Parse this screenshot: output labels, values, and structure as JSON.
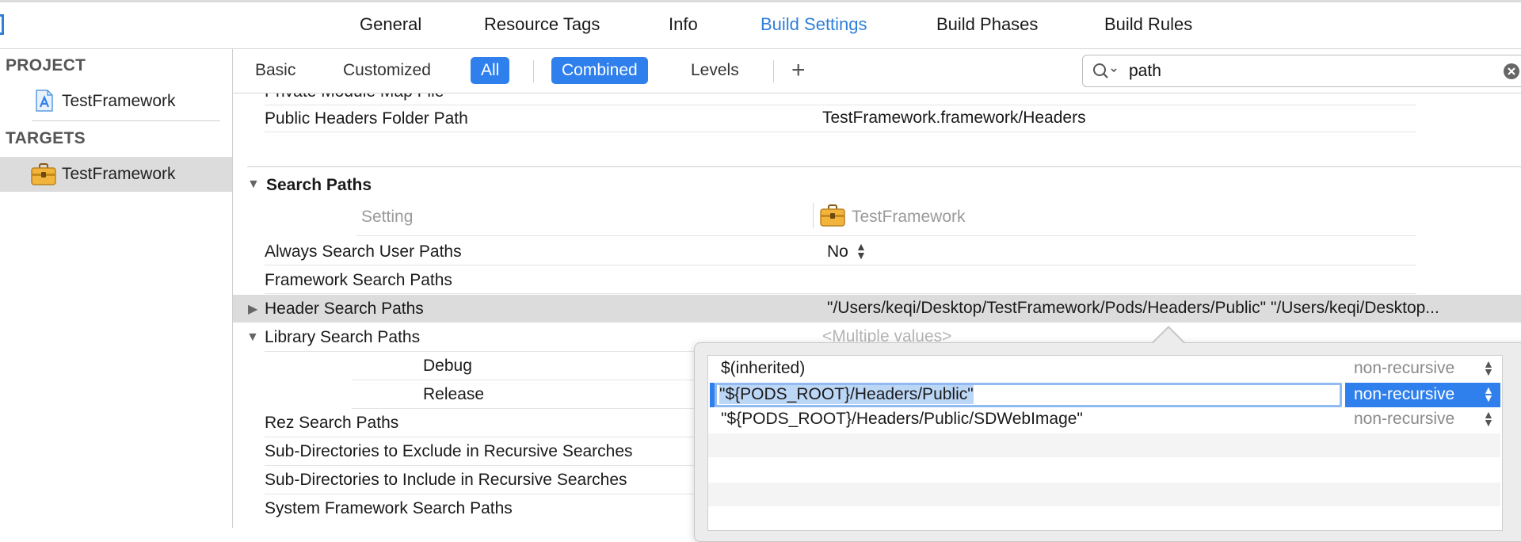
{
  "tabs": [
    "General",
    "Resource Tags",
    "Info",
    "Build Settings",
    "Build Phases",
    "Build Rules"
  ],
  "active_tab": "Build Settings",
  "sidebar": {
    "project_header": "PROJECT",
    "project_item": "TestFramework",
    "targets_header": "TARGETS",
    "target_item": "TestFramework"
  },
  "filter": {
    "basic": "Basic",
    "customized": "Customized",
    "all": "All",
    "combined": "Combined",
    "levels": "Levels",
    "add": "+"
  },
  "search": {
    "value": "path"
  },
  "settings": {
    "cut_row_label": "Private Module Map File",
    "public_headers_label": "Public Headers Folder Path",
    "public_headers_value": "TestFramework.framework/Headers",
    "section_title": "Search Paths",
    "col_setting": "Setting",
    "col_target": "TestFramework",
    "always_search_label": "Always Search User Paths",
    "always_search_value": "No",
    "framework_search_label": "Framework Search Paths",
    "header_search_label": "Header Search Paths",
    "header_search_value": "\"/Users/keqi/Desktop/TestFramework/Pods/Headers/Public\" \"/Users/keqi/Desktop...",
    "library_search_label": "Library Search Paths",
    "library_search_value": "<Multiple values>",
    "debug_label": "Debug",
    "release_label": "Release",
    "rez_label": "Rez Search Paths",
    "subdir_exclude_label": "Sub-Directories to Exclude in Recursive Searches",
    "subdir_include_label": "Sub-Directories to Include in Recursive Searches",
    "system_framework_label": "System Framework Search Paths"
  },
  "popover": {
    "rows": [
      {
        "path": "$(inherited)",
        "mode": "non-recursive"
      },
      {
        "path": "\"${PODS_ROOT}/Headers/Public\"",
        "mode": "non-recursive"
      },
      {
        "path": "\"${PODS_ROOT}/Headers/Public/SDWebImage\"",
        "mode": "non-recursive"
      }
    ]
  },
  "colors": {
    "accent": "#2f80ed",
    "active_tab": "#2f7fd8",
    "selection": "#bcd6f6"
  }
}
